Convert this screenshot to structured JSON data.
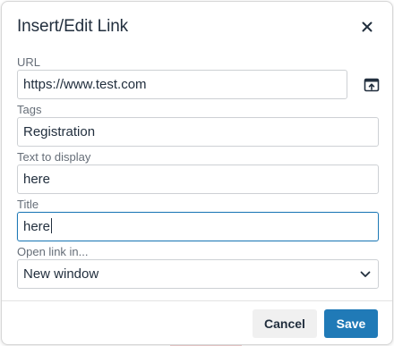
{
  "dialog": {
    "title": "Insert/Edit Link",
    "close_icon": "close-icon"
  },
  "fields": {
    "url": {
      "label": "URL",
      "value": "https://www.test.com",
      "browse_icon": "browse-link-icon"
    },
    "tags": {
      "label": "Tags",
      "value": "Registration"
    },
    "text_to_display": {
      "label": "Text to display",
      "value": "here"
    },
    "title": {
      "label": "Title",
      "value": "here"
    },
    "open_link_in": {
      "label": "Open link in...",
      "selected": "New window",
      "icon": "chevron-down-icon"
    }
  },
  "footer": {
    "cancel_label": "Cancel",
    "save_label": "Save"
  },
  "colors": {
    "primary": "#207ab7",
    "focus_border": "#207ab7",
    "cancel_bg": "#f0f0f0"
  }
}
